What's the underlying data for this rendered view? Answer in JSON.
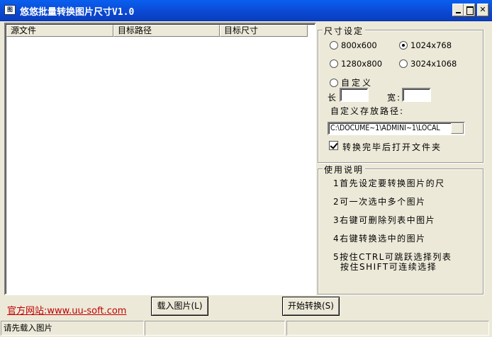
{
  "window": {
    "title": "悠悠批量转换图片尺寸V1.0",
    "icon_text": "图",
    "controls": [
      "minimize-icon",
      "maximize-icon",
      "close-icon"
    ]
  },
  "list": {
    "columns": [
      "源文件",
      "目标路径",
      "目标尺寸"
    ],
    "rows": []
  },
  "size_group": {
    "title": "尺寸设定",
    "options": [
      {
        "label": "800x600",
        "selected": false
      },
      {
        "label": "1024x768",
        "selected": true
      },
      {
        "label": "1280x800",
        "selected": false
      },
      {
        "label": "3024x1068",
        "selected": false
      }
    ],
    "custom_label": "自定义",
    "length_label": "长",
    "width_label": "宽:",
    "length_value": "",
    "width_value": "",
    "path_label": "自定义存放路径:",
    "path_value": "C:\\DOCUME~1\\ADMINI~1\\LOCAL",
    "open_folder_label": "转换完毕后打开文件夹",
    "open_folder_checked": true
  },
  "help_group": {
    "title": "使用说明",
    "lines": [
      "1首先设定要转换图片的尺",
      "2可一次选中多个图片",
      "3右键可删除列表中图片",
      "4右键转换选中的图片",
      "5按住CTRL可跳跃选择列表",
      "按住SHIFT可连续选择"
    ]
  },
  "footer": {
    "site_link": "官方网站:www.uu-soft.com",
    "load_button": "载入图片(L)",
    "start_button": "开始转换(S)"
  },
  "status": {
    "panels": [
      "请先载入图片",
      "",
      ""
    ]
  }
}
